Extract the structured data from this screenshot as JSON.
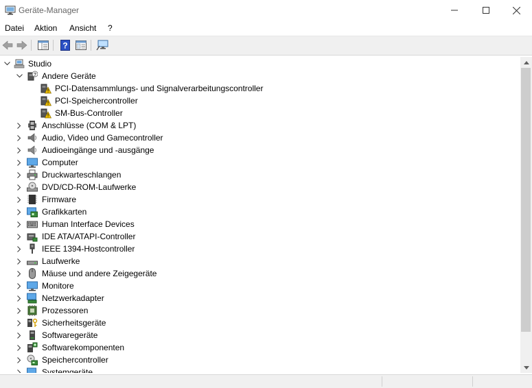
{
  "window": {
    "title": "Geräte-Manager",
    "controls": {
      "minimize": "—",
      "maximize": "☐",
      "close": "✕"
    }
  },
  "menu": [
    "Datei",
    "Aktion",
    "Ansicht",
    "?"
  ],
  "toolbar": [
    "back-arrow-icon",
    "forward-arrow-icon",
    "properties-pane-icon",
    "help-icon",
    "console-icon",
    "scan-hardware-icon"
  ],
  "tree": {
    "root": "Studio",
    "expanded_category": "Andere Geräte",
    "expanded_children": [
      "PCI-Datensammlungs- und Signalverarbeitungscontroller",
      "PCI-Speichercontroller",
      "SM-Bus-Controller"
    ],
    "categories": [
      "Anschlüsse (COM & LPT)",
      "Audio, Video und Gamecontroller",
      "Audioeingänge und -ausgänge",
      "Computer",
      "Druckwarteschlangen",
      "DVD/CD-ROM-Laufwerke",
      "Firmware",
      "Grafikkarten",
      "Human Interface Devices",
      "IDE ATA/ATAPI-Controller",
      "IEEE 1394-Hostcontroller",
      "Laufwerke",
      "Mäuse und andere Zeigegeräte",
      "Monitore",
      "Netzwerkadapter",
      "Prozessoren",
      "Sicherheitsgeräte",
      "Softwaregeräte",
      "Softwarekomponenten",
      "Speichercontroller",
      "Systemgeräte"
    ]
  }
}
